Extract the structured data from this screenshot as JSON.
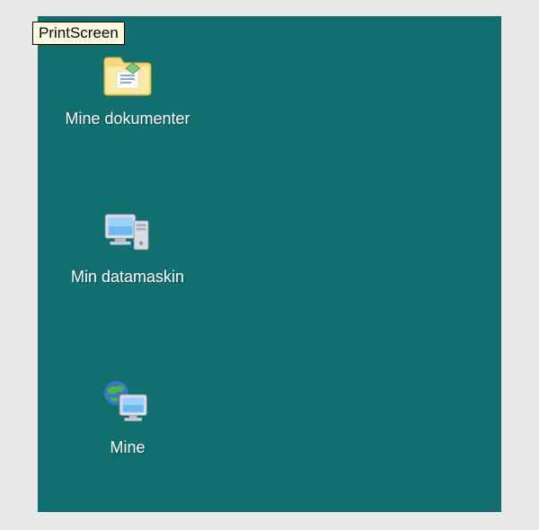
{
  "tooltip": {
    "text": "PrintScreen"
  },
  "desktop": {
    "icons": [
      {
        "label": "Mine dokumenter"
      },
      {
        "label": "Min datamaskin"
      },
      {
        "label": "Mine"
      }
    ]
  }
}
